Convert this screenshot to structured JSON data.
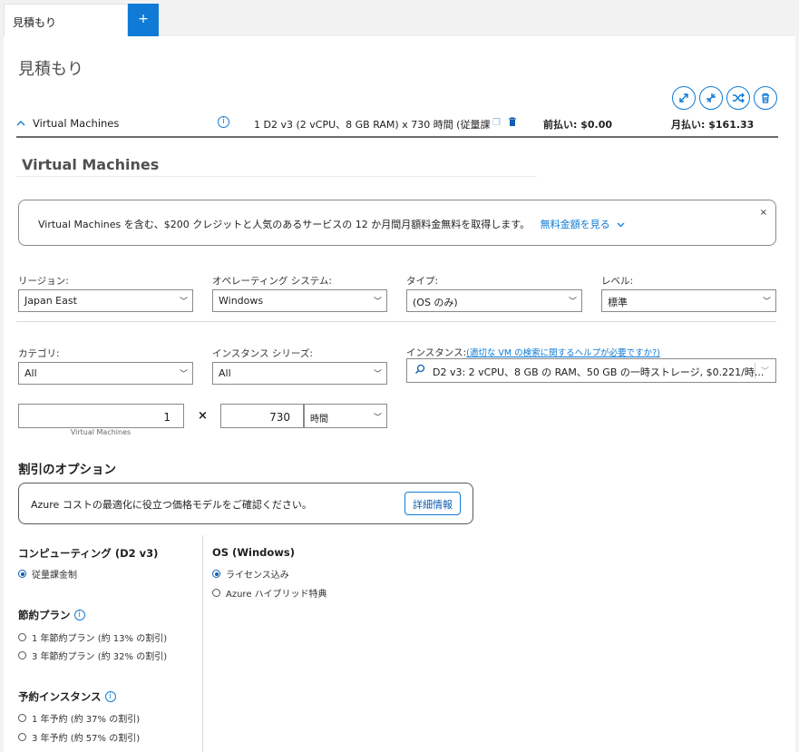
{
  "tabs": {
    "active_label": "見積もり",
    "add_label": "+"
  },
  "page": {
    "title": "見積もり"
  },
  "summary": {
    "service_name": "Virtual Machines",
    "description": "1 D2 v3 (2 vCPU、8 GB RAM) x 730 時間 (従量課...",
    "upfront": "前払い: $0.00",
    "monthly": "月払い: $161.33"
  },
  "section": {
    "name": "Virtual Machines"
  },
  "promo": {
    "text": "Virtual Machines を含む、$200 クレジットと人気のあるサービスの 12 か月間月額料金無料を取得します。",
    "link": "無料金額を見る",
    "close": "×"
  },
  "filters": {
    "region": {
      "label": "リージョン:",
      "value": "Japan East"
    },
    "os": {
      "label": "オペレーティング システム:",
      "value": "Windows"
    },
    "type": {
      "label": "タイプ:",
      "value": "(OS のみ)"
    },
    "level": {
      "label": "レベル:",
      "value": "標準"
    },
    "category": {
      "label": "カテゴリ:",
      "value": "All"
    },
    "series": {
      "label": "インスタンス シリーズ:",
      "value": "All"
    },
    "instance": {
      "label": "インスタンス:",
      "help_link": "(適切な VM の検索に関するヘルプが必要ですか?)",
      "value": "D2 v3: 2 vCPU、8 GB の RAM、50 GB の一時ストレージ, $0.221/時..."
    }
  },
  "quantity": {
    "count": "1",
    "count_label": "Virtual Machines",
    "times": "×",
    "hours": "730",
    "unit": "時間"
  },
  "discount": {
    "heading": "割引のオプション",
    "info_text": "Azure コストの最適化に役立つ価格モデルをご確認ください。",
    "detail_button": "詳細情報"
  },
  "compute": {
    "heading": "コンピューティング (D2 v3)",
    "payg": "従量課金制",
    "savings_heading": "節約プラン",
    "savings_1": "1 年節約プラン (約 13% の割引)",
    "savings_3": "3 年節約プラン (約 32% の割引)",
    "reserved_heading": "予約インスタンス",
    "reserved_1": "1 年予約 (約 37% の割引)",
    "reserved_3": "3 年予約 (約 57% の割引)"
  },
  "os_options": {
    "heading": "OS (Windows)",
    "license": "ライセンス込み",
    "hybrid": "Azure ハイブリッド特典"
  },
  "colors": {
    "accent": "#0f7bd6",
    "accent_dark": "#0f5fb0"
  }
}
